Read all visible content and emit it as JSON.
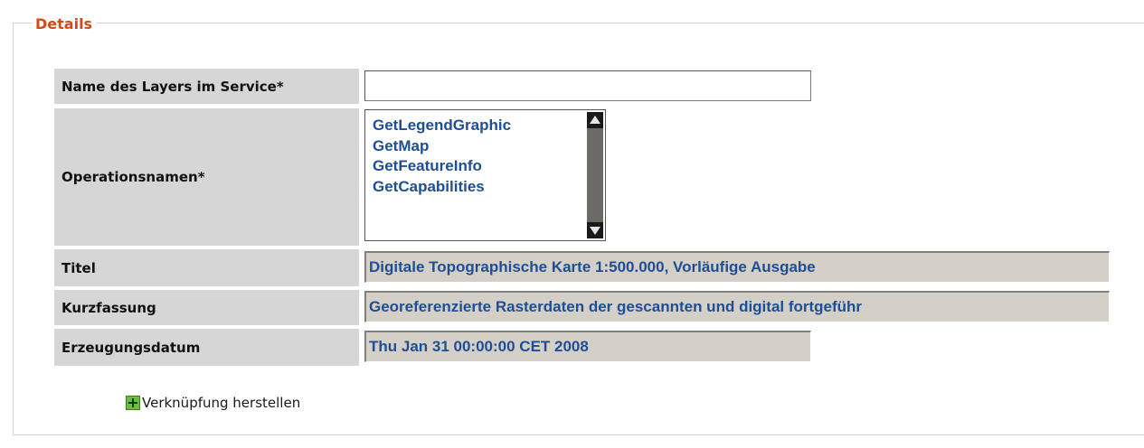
{
  "section": {
    "legend": "Details"
  },
  "fields": {
    "layer_name": {
      "label": "Name des Layers im Service*",
      "value": ""
    },
    "operations": {
      "label": "Operationsnamen*",
      "options": [
        "GetLegendGraphic",
        "GetMap",
        "GetFeatureInfo",
        "GetCapabilities"
      ]
    },
    "title": {
      "label": "Titel",
      "value": "Digitale Topographische Karte 1:500.000, Vorläufige Ausgabe"
    },
    "abstract": {
      "label": "Kurzfassung",
      "value": "Georeferenzierte Rasterdaten der gescannten und digital fortgeführ"
    },
    "created": {
      "label": "Erzeugungsdatum",
      "value": "Thu Jan 31 00:00:00 CET 2008"
    }
  },
  "actions": {
    "add_link": "Verknüpfung herstellen",
    "add_icon": "plus-icon"
  },
  "colors": {
    "legend": "#d24a1a",
    "value_text": "#1f4e94",
    "label_bg": "#d6d6d6",
    "readonly_bg": "#d4d0c8",
    "plus_icon": "#6abf3c"
  }
}
